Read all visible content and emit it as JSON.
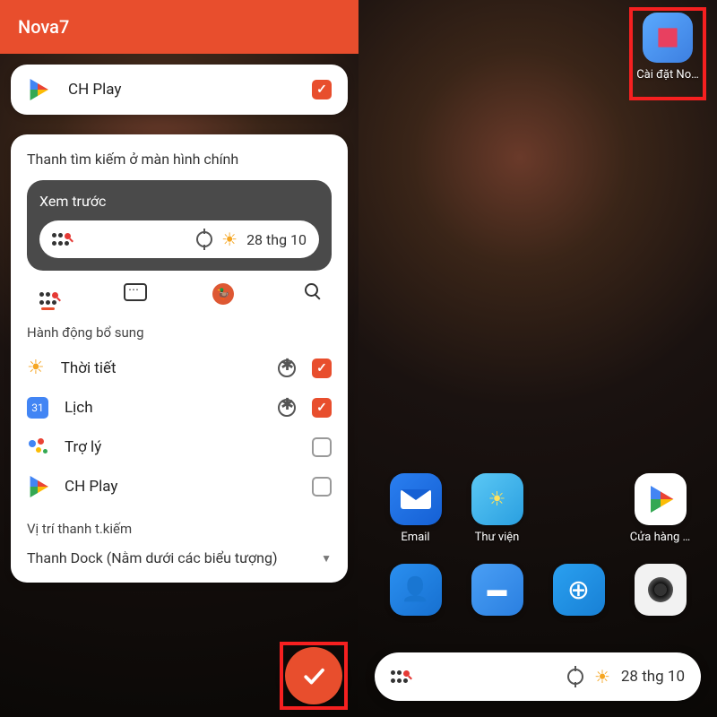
{
  "left": {
    "header_title": "Nova7",
    "top_item_label": "CH Play",
    "section_title": "Thanh tìm kiếm ở màn hình chính",
    "preview_title": "Xem trước",
    "preview_date": "28 thg 10",
    "actions_title": "Hành động bổ sung",
    "rows": {
      "weather": "Thời tiết",
      "calendar": "Lịch",
      "calendar_day": "31",
      "assistant": "Trợ lý",
      "chplay": "CH Play"
    },
    "position_label": "Vị trí thanh t.kiếm",
    "dropdown_value": "Thanh Dock (Nằm dưới các biểu tượng)"
  },
  "right": {
    "nova_label": "Cài đặt No…",
    "apps": {
      "email": "Email",
      "gallery": "Thư viện",
      "store": "Cửa hàng …",
      "hidden": "."
    },
    "search_date": "28 thg 10"
  }
}
